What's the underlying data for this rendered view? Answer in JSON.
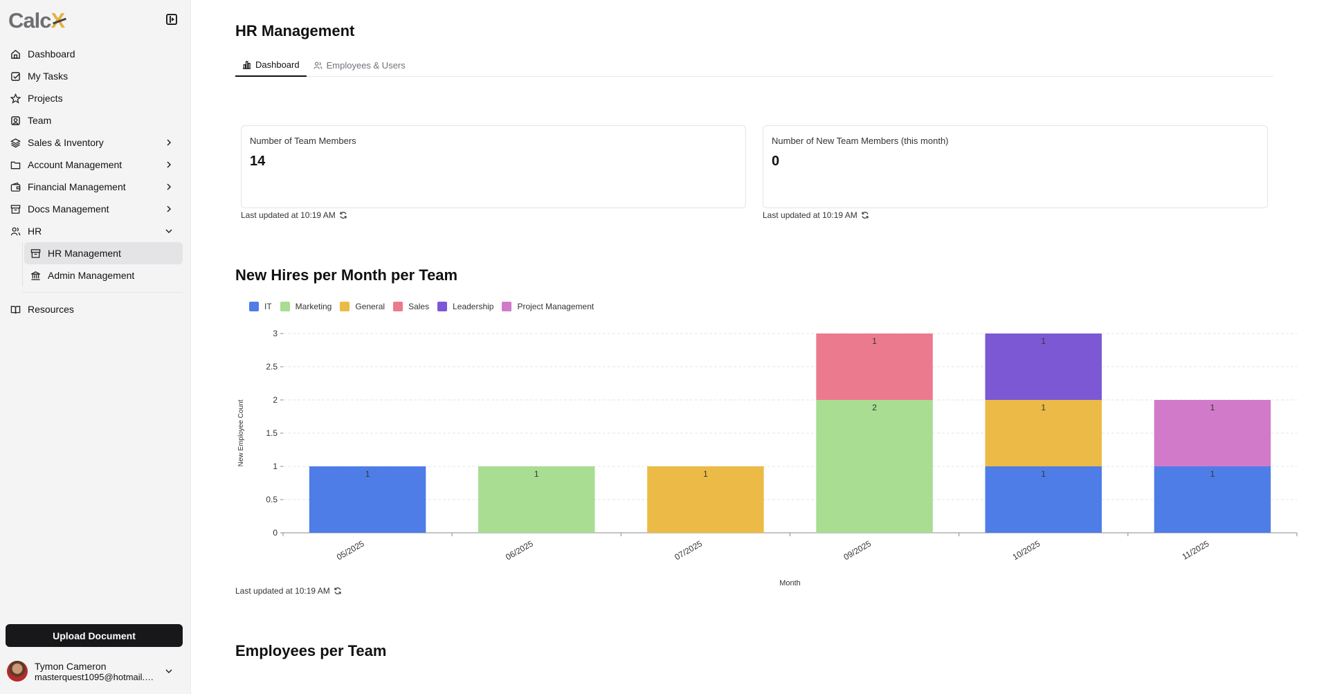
{
  "app": {
    "logo_main": "Calc",
    "logo_accent": "X"
  },
  "sidebar": {
    "items": [
      {
        "label": "Dashboard"
      },
      {
        "label": "My Tasks"
      },
      {
        "label": "Projects"
      },
      {
        "label": "Team"
      },
      {
        "label": "Sales & Inventory"
      },
      {
        "label": "Account Management"
      },
      {
        "label": "Financial Management"
      },
      {
        "label": "Docs Management"
      },
      {
        "label": "HR"
      }
    ],
    "hr_sub": [
      {
        "label": "HR Management"
      },
      {
        "label": "Admin Management"
      }
    ],
    "resources_label": "Resources",
    "upload_label": "Upload Document",
    "user": {
      "name": "Tymon Cameron",
      "email": "masterquest1095@hotmail.c..."
    }
  },
  "page": {
    "title": "HR Management",
    "tabs": [
      {
        "label": "Dashboard"
      },
      {
        "label": "Employees & Users"
      }
    ]
  },
  "cards": [
    {
      "label": "Number of Team Members",
      "value": "14",
      "updated": "Last updated at 10:19 AM"
    },
    {
      "label": "Number of New Team Members (this month)",
      "value": "0",
      "updated": "Last updated at 10:19 AM"
    }
  ],
  "sections": {
    "hires_title": "New Hires per Month per Team",
    "hires_updated": "Last updated at 10:19 AM",
    "employees_title": "Employees per Team"
  },
  "chart_data": {
    "type": "bar",
    "stacked": true,
    "title": "New Hires per Month per Team",
    "xlabel": "Month",
    "ylabel": "New Employee Count",
    "ylim": [
      0,
      3
    ],
    "yticks": [
      "0",
      "0.5",
      "1",
      "1.5",
      "2",
      "2.5",
      "3"
    ],
    "categories": [
      "05/2025",
      "06/2025",
      "07/2025",
      "09/2025",
      "10/2025",
      "11/2025"
    ],
    "legend_position": "top-left",
    "grid": true,
    "series": [
      {
        "name": "IT",
        "color": "#4f7de8",
        "values": [
          1,
          0,
          0,
          0,
          1,
          1
        ]
      },
      {
        "name": "Marketing",
        "color": "#a8dd92",
        "values": [
          0,
          1,
          0,
          2,
          0,
          0
        ]
      },
      {
        "name": "General",
        "color": "#ecba46",
        "values": [
          0,
          0,
          1,
          0,
          1,
          0
        ]
      },
      {
        "name": "Sales",
        "color": "#ec7a8e",
        "values": [
          0,
          0,
          0,
          1,
          0,
          0
        ]
      },
      {
        "name": "Leadership",
        "color": "#7c58d4",
        "values": [
          0,
          0,
          0,
          0,
          1,
          0
        ]
      },
      {
        "name": "Project Management",
        "color": "#d17ac9",
        "values": [
          0,
          0,
          0,
          0,
          0,
          1
        ]
      }
    ]
  }
}
